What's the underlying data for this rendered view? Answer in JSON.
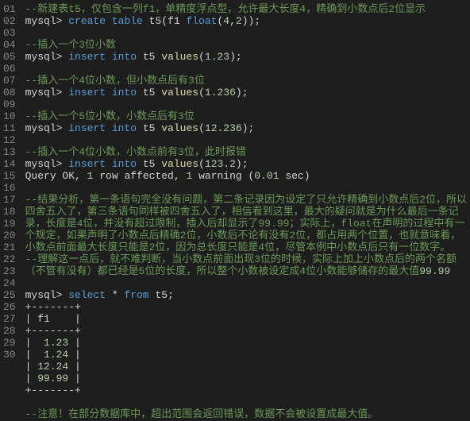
{
  "lines": [
    {
      "n": "01",
      "cls": "",
      "spans": [
        {
          "c": "cmt",
          "t": "--新建表t5，仅包含一列f1，单精度浮点型，允许最大长度4，精确到小数点后2位显示"
        }
      ]
    },
    {
      "n": "02",
      "cls": "",
      "spans": [
        {
          "c": "prompt",
          "t": "mysql> "
        },
        {
          "c": "kw",
          "t": "create"
        },
        {
          "c": "",
          "t": " "
        },
        {
          "c": "kw",
          "t": "table"
        },
        {
          "c": "",
          "t": " t5(f1 "
        },
        {
          "c": "kw",
          "t": "float"
        },
        {
          "c": "",
          "t": "("
        },
        {
          "c": "num",
          "t": "4"
        },
        {
          "c": "",
          "t": ","
        },
        {
          "c": "num",
          "t": "2"
        },
        {
          "c": "",
          "t": "));"
        }
      ]
    },
    {
      "n": "03",
      "cls": "",
      "spans": [
        {
          "c": "",
          "t": ""
        }
      ]
    },
    {
      "n": "04",
      "cls": "",
      "spans": [
        {
          "c": "cmt",
          "t": "--插入一个3位小数"
        }
      ]
    },
    {
      "n": "05",
      "cls": "",
      "spans": [
        {
          "c": "prompt",
          "t": "mysql> "
        },
        {
          "c": "kw",
          "t": "insert"
        },
        {
          "c": "",
          "t": " "
        },
        {
          "c": "kw",
          "t": "into"
        },
        {
          "c": "",
          "t": " t5 "
        },
        {
          "c": "fn",
          "t": "values"
        },
        {
          "c": "",
          "t": "("
        },
        {
          "c": "num",
          "t": "1.23"
        },
        {
          "c": "",
          "t": ");"
        }
      ]
    },
    {
      "n": "06",
      "cls": "",
      "spans": [
        {
          "c": "",
          "t": ""
        }
      ]
    },
    {
      "n": "07",
      "cls": "",
      "spans": [
        {
          "c": "cmt",
          "t": "--插入一个4位小数，但小数点后有3位"
        }
      ]
    },
    {
      "n": "08",
      "cls": "",
      "spans": [
        {
          "c": "prompt",
          "t": "mysql> "
        },
        {
          "c": "kw",
          "t": "insert"
        },
        {
          "c": "",
          "t": " "
        },
        {
          "c": "kw",
          "t": "into"
        },
        {
          "c": "",
          "t": " t5 "
        },
        {
          "c": "fn",
          "t": "values"
        },
        {
          "c": "",
          "t": "("
        },
        {
          "c": "num",
          "t": "1.236"
        },
        {
          "c": "",
          "t": ");"
        }
      ]
    },
    {
      "n": "09",
      "cls": "",
      "spans": [
        {
          "c": "",
          "t": ""
        }
      ]
    },
    {
      "n": "10",
      "cls": "",
      "spans": [
        {
          "c": "cmt",
          "t": "--插入一个5位小数，小数点后有3位"
        }
      ]
    },
    {
      "n": "11",
      "cls": "",
      "spans": [
        {
          "c": "prompt",
          "t": "mysql> "
        },
        {
          "c": "kw",
          "t": "insert"
        },
        {
          "c": "",
          "t": " "
        },
        {
          "c": "kw",
          "t": "into"
        },
        {
          "c": "",
          "t": " t5 "
        },
        {
          "c": "fn",
          "t": "values"
        },
        {
          "c": "",
          "t": "("
        },
        {
          "c": "num",
          "t": "12.236"
        },
        {
          "c": "",
          "t": ");"
        }
      ]
    },
    {
      "n": "12",
      "cls": "",
      "spans": [
        {
          "c": "",
          "t": ""
        }
      ]
    },
    {
      "n": "13",
      "cls": "",
      "spans": [
        {
          "c": "cmt",
          "t": "--插入一个4位小数，小数点前有3位，此时报错"
        }
      ]
    },
    {
      "n": "14",
      "cls": "",
      "spans": [
        {
          "c": "prompt",
          "t": "mysql> "
        },
        {
          "c": "kw",
          "t": "insert"
        },
        {
          "c": "",
          "t": " "
        },
        {
          "c": "kw",
          "t": "into"
        },
        {
          "c": "",
          "t": " t5 "
        },
        {
          "c": "fn",
          "t": "values"
        },
        {
          "c": "",
          "t": "("
        },
        {
          "c": "num",
          "t": "123.2"
        },
        {
          "c": "",
          "t": ");"
        }
      ]
    },
    {
      "n": "15",
      "cls": "",
      "spans": [
        {
          "c": "",
          "t": "Query OK, "
        },
        {
          "c": "num",
          "t": "1"
        },
        {
          "c": "",
          "t": " row affected, "
        },
        {
          "c": "num",
          "t": "1"
        },
        {
          "c": "",
          "t": " warning ("
        },
        {
          "c": "num",
          "t": "0.01"
        },
        {
          "c": "",
          "t": " sec)"
        }
      ]
    },
    {
      "n": "16",
      "cls": "",
      "spans": [
        {
          "c": "",
          "t": ""
        }
      ]
    },
    {
      "n": "17",
      "cls": "tall3",
      "spans": [
        {
          "c": "cmt",
          "t": "--结果分析，第一条语句完全没有问题，第二条记录因为设定了只允许精确到小数点后2位，所以四舍五入了，第三条语句同样被四舍五入了，相信看到这里，最大的疑问就是为什么最后一条记录，长度是4位，并没有超过限制，插入后却显示了99.99；实际上，float在声明的过程中有一个规定，如果声明了小数点后精确2位，小数后不论有没有2位，都占用两个位置，也就意味着，小数点前面最大长度只能是2位，因为总长度只能是4位，尽管本例中小数点后只有一位数字。"
        }
      ]
    },
    {
      "n": "18",
      "cls": "",
      "spans": [
        {
          "c": "",
          "t": ""
        }
      ]
    },
    {
      "n": "19",
      "cls": "tall2",
      "spans": [
        {
          "c": "cmt",
          "t": "--理解这一点后，就不难判断，当小数点前面出现3位的时候，实际上加上小数点后的两个名额（不管有没有）都已经是5位的长度，所以整个小数被设定成4位小数能够储存的最大值"
        },
        {
          "c": "num",
          "t": "99.99"
        }
      ]
    },
    {
      "n": "20",
      "cls": "",
      "spans": [
        {
          "c": "prompt",
          "t": "mysql> "
        },
        {
          "c": "kw",
          "t": "select"
        },
        {
          "c": "",
          "t": " "
        },
        {
          "c": "op",
          "t": "*"
        },
        {
          "c": "",
          "t": " "
        },
        {
          "c": "kw",
          "t": "from"
        },
        {
          "c": "",
          "t": " t5;"
        }
      ]
    },
    {
      "n": "21",
      "cls": "",
      "spans": [
        {
          "c": "",
          "t": "+-------+"
        }
      ]
    },
    {
      "n": "22",
      "cls": "",
      "spans": [
        {
          "c": "",
          "t": "| f1    |"
        }
      ]
    },
    {
      "n": "23",
      "cls": "",
      "spans": [
        {
          "c": "",
          "t": "+-------+"
        }
      ]
    },
    {
      "n": "24",
      "cls": "",
      "spans": [
        {
          "c": "",
          "t": "|  "
        },
        {
          "c": "num",
          "t": "1.23"
        },
        {
          "c": "",
          "t": " |"
        }
      ]
    },
    {
      "n": "25",
      "cls": "",
      "spans": [
        {
          "c": "",
          "t": "|  "
        },
        {
          "c": "num",
          "t": "1.24"
        },
        {
          "c": "",
          "t": " |"
        }
      ]
    },
    {
      "n": "26",
      "cls": "",
      "spans": [
        {
          "c": "",
          "t": "| "
        },
        {
          "c": "num",
          "t": "12.24"
        },
        {
          "c": "",
          "t": " |"
        }
      ]
    },
    {
      "n": "27",
      "cls": "",
      "spans": [
        {
          "c": "",
          "t": "| "
        },
        {
          "c": "num",
          "t": "99.99"
        },
        {
          "c": "",
          "t": " |"
        }
      ]
    },
    {
      "n": "28",
      "cls": "",
      "spans": [
        {
          "c": "",
          "t": "+-------+"
        }
      ]
    },
    {
      "n": "29",
      "cls": "",
      "spans": [
        {
          "c": "",
          "t": ""
        }
      ]
    },
    {
      "n": "30",
      "cls": "",
      "spans": [
        {
          "c": "cmt",
          "t": "--注意！在部分数据库中，超出范围会返回错误，数据不会被设置成最大值。"
        }
      ]
    }
  ]
}
